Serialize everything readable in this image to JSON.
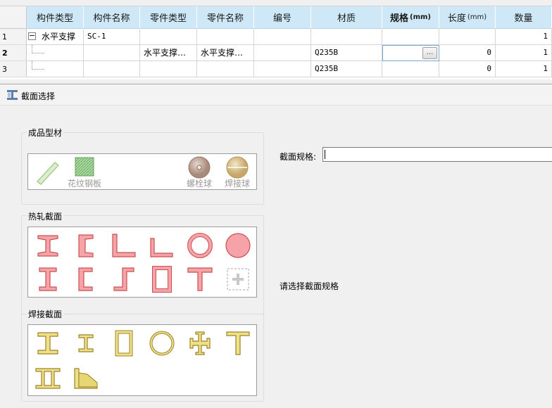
{
  "grid": {
    "columns": [
      {
        "label": "构件类型",
        "unit": "",
        "bold": false
      },
      {
        "label": "构件名称",
        "unit": "",
        "bold": false
      },
      {
        "label": "零件类型",
        "unit": "",
        "bold": false
      },
      {
        "label": "零件名称",
        "unit": "",
        "bold": false
      },
      {
        "label": "编号",
        "unit": "",
        "bold": false
      },
      {
        "label": "材质",
        "unit": "",
        "bold": false
      },
      {
        "label": "规格",
        "unit": "(mm)",
        "bold": true
      },
      {
        "label": "长度",
        "unit": "(mm)",
        "bold": false
      },
      {
        "label": "数量",
        "unit": "",
        "bold": false
      }
    ],
    "rows": [
      {
        "num": "1",
        "expander": "−",
        "cells": [
          "水平支撑",
          "SC-1",
          "",
          "",
          "",
          "",
          "",
          "",
          "1"
        ]
      },
      {
        "num": "2",
        "cells": [
          "",
          "",
          "水平支撑…",
          "水平支撑…",
          "",
          "Q235B",
          "",
          "0",
          "1"
        ],
        "button": "..."
      },
      {
        "num": "3",
        "cells": [
          "",
          "",
          "",
          "",
          "",
          "Q235B",
          "",
          "0",
          "1"
        ]
      }
    ]
  },
  "dialog": {
    "title": "截面选择",
    "groups": {
      "finished": {
        "title": "成品型材",
        "items": [
          {
            "label": "",
            "icon": "flat-bar-icon"
          },
          {
            "label": "花纹钢板",
            "icon": "checkered-plate-icon"
          },
          {
            "label": "螺栓球",
            "icon": "bolt-ball-icon"
          },
          {
            "label": "焊接球",
            "icon": "welded-ball-icon"
          }
        ]
      },
      "hot_rolled": {
        "title": "热轧截面",
        "icons": [
          "i-beam-icon",
          "channel-icon",
          "equal-angle-icon",
          "unequal-angle-icon",
          "round-tube-icon",
          "round-bar-icon",
          "h-beam-icon",
          "double-channel-icon",
          "z-section-icon",
          "rect-tube-icon",
          "t-section-icon",
          "add-section-icon"
        ]
      },
      "welded": {
        "title": "焊接截面",
        "icons": [
          "welded-i-beam-icon",
          "welded-h-icon",
          "welded-box-icon",
          "welded-circular-icon",
          "welded-cross-icon",
          "welded-t-icon",
          "welded-double-box-icon",
          "welded-tapered-icon"
        ]
      }
    },
    "spec_label": "截面规格:",
    "spec_value": "",
    "hint": "请选择截面规格"
  },
  "colors": {
    "header_bg": "#cfe8f8",
    "hot_rolled_fill": "#f5a3a8",
    "hot_rolled_stroke": "#c9504f",
    "welded_fill": "#f0e08a",
    "welded_stroke": "#9c8426"
  }
}
